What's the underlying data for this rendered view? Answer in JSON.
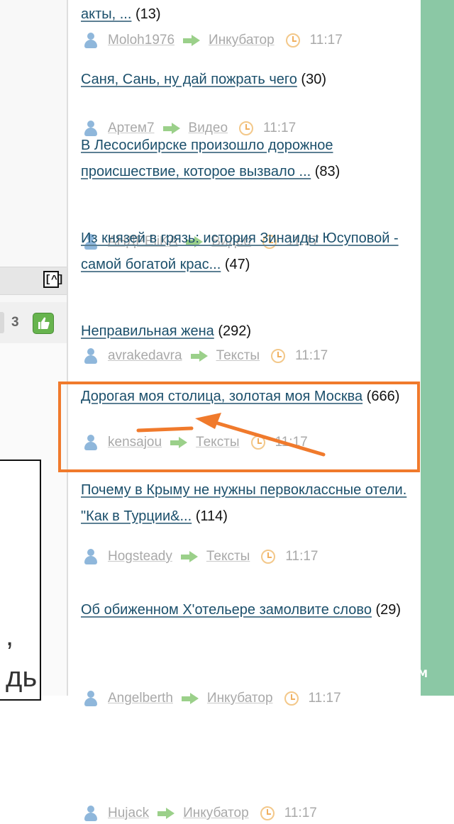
{
  "watermark": "YAPLAKAL.COM",
  "left_panel": {
    "scroll_up_label": "[^]",
    "vote_count": "3",
    "quote_text": ",\nдь"
  },
  "posts": [
    {
      "title": "акты, ...",
      "count": "(13)",
      "author": "Moloh1976",
      "section": "Инкубатор",
      "time": "11:17"
    },
    {
      "title": "Саня, Сань, ну дай пожрать чего",
      "count": "(30)",
      "author": "Артем7",
      "section": "Видео",
      "time": "11:17"
    },
    {
      "title": "В Лесосибирске произошло дорожное происшествие, которое вызвало ...",
      "count": "(83)",
      "author": "AHДРEiiKA",
      "section": "Видео",
      "time": "11:17"
    },
    {
      "title": "Из князей в грязь: история Зинаиды Юсуповой - самой богатой крас...",
      "count": "(47)",
      "author": "avrakedavra",
      "section": "Тексты",
      "time": "11:17"
    },
    {
      "title": "Неправильная жена",
      "count": "(292)",
      "author": "kensajou",
      "section": "Тексты",
      "time": "11:17"
    },
    {
      "title": "Дорогая моя столица, золотая моя Москва",
      "count": "(666)",
      "author": "Hogsteady",
      "section": "Тексты",
      "time": "11:17"
    },
    {
      "title": "Почему в Крыму не нужны первоклассные отели. \"Как в Турции&...",
      "count": "(114)",
      "author": "Angelberth",
      "section": "Инкубатор",
      "time": "11:17"
    },
    {
      "title": "Об обиженном Х'отельере замолвите слово",
      "count": "(29)",
      "author": "Hujack",
      "section": "Инкубатор",
      "time": "11:17"
    }
  ],
  "colors": {
    "link": "#1b4f6b",
    "meta": "#a9a9a9",
    "annotation": "#f07a2c",
    "right_strip": "#8bc8a5"
  }
}
